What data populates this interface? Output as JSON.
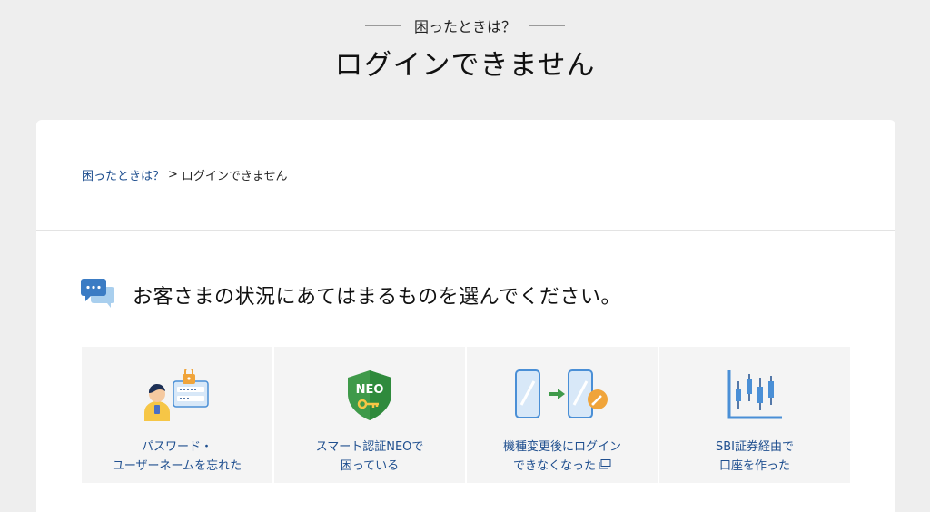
{
  "header": {
    "eyebrow": "困ったときは？",
    "title": "ログインできません"
  },
  "breadcrumb": {
    "parent": "困ったときは？",
    "separator": ">",
    "current": "ログインできません"
  },
  "question": {
    "text": "お客さまの状況にあてはまるものを選んでください。"
  },
  "options": [
    {
      "line1": "パスワード・",
      "line2": "ユーザーネームを忘れた"
    },
    {
      "line1": "スマート認証NEOで",
      "line2": "困っている"
    },
    {
      "line1": "機種変更後にログイン",
      "line2": "できなくなった"
    },
    {
      "line1": "SBI証券経由で",
      "line2": "口座を作った"
    }
  ],
  "shield_text": "NEO",
  "colors": {
    "background": "#eeeeee",
    "link": "#1f4f8f",
    "accent_blue": "#4a8fd6",
    "accent_green": "#3f9a4a",
    "accent_orange": "#f0a43a"
  }
}
